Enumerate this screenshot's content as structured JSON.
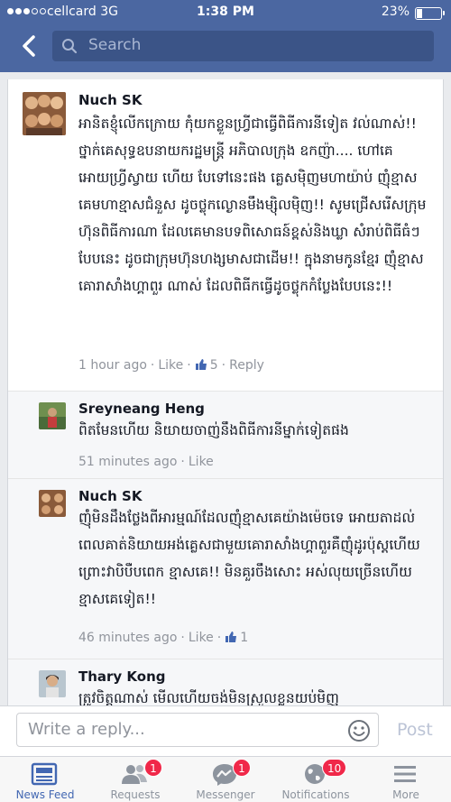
{
  "status_bar": {
    "carrier": "cellcard  3G",
    "time": "1:38 PM",
    "battery": "23%"
  },
  "search": {
    "placeholder": "Search"
  },
  "comments": [
    {
      "author": "Nuch SK",
      "text": "អានិតខ្ញុំលើកក្រោយ កុំយកខ្លួនហ្វ្រីជាធ្វើពិធីការនីទៀត វល់ណាស់!! ថ្នាក់គេសុទ្ធឧបនាយករដ្ឋមន្ត្រី អភិបាលក្រុង ឧកញ៉ា.... ហៅគេអោយហ្វ្រីស្វាយ ហើយ បែទៅនេះផង គ្លេសម៉ិញមហាយ៉ាប់ ញុំខ្មាសគេមហាខ្មាសជំនួស ដូចថ្លុកល្ងោនមឹងម្ស៉ិលម៉ិញ!! សូមជ្រើសរើសក្រុមហ៊ុនពិធីការណា ដែលគេមានបទពិសោធន៍ខ្ពស់និងឃ្លា សំរាប់ពិធីធំៗបែបនេះ ដូចជាក្រុមហ៊ុនហង្សមាសជាដើម!! ក្នុងនាមកូនខ្មែរ ញ៉ុំខ្មាសគោរាសាំងហ្គាពួរ ណាស់ ដែលពិធីកធ្វើដូចថ្លុកកំប្លែងបែបនេះ!!",
      "time": "1 hour ago",
      "like": "Like",
      "likes": "5",
      "reply": "Reply"
    },
    {
      "author": "Sreyneang Heng",
      "text": "ពិតមែនហើយ និយាយចាញ់នឹងពិធីការនីម្នាក់ទៀតផង",
      "time": "51 minutes ago",
      "like": "Like"
    },
    {
      "author": "Nuch SK",
      "text": "ញ៉ុំមិនដឹងថ្លែងពីអារម្មណ៍ដែលញុំខ្មាសគេយ៉ាងម៉េចទេ អោយតាដល់ពេលគាត់និយាយអង់គ្លេសជាមួយគោរាសាំងហ្គាពួរគឺញុំដូរប៉ុស្តហើយ ព្រោះវាបិបឺបពេក ខ្មាសគេ!! មិនគួរចឹងសោះ អស់លុយច្រើនហើយ ខ្មាសគេទៀត!!",
      "time": "46 minutes ago",
      "like": "Like",
      "likes": "1"
    },
    {
      "author": "Thary Kong",
      "text": "ត្រូវចិត្តណាស់ មើលហើយចង់មិនស្រួលខ្លួនយប់មិញ"
    }
  ],
  "reply_bar": {
    "placeholder": "Write a reply...",
    "post": "Post"
  },
  "tabs": [
    {
      "label": "News Feed",
      "icon": "news-feed-icon"
    },
    {
      "label": "Requests",
      "icon": "friend-requests-icon",
      "badge": "1"
    },
    {
      "label": "Messenger",
      "icon": "messenger-icon",
      "badge": "1"
    },
    {
      "label": "Notifications",
      "icon": "globe-icon",
      "badge": "10"
    },
    {
      "label": "More",
      "icon": "menu-icon"
    }
  ],
  "colors": {
    "brand": "#4b67a1",
    "link_blue": "#4267b2",
    "badge_red": "#f02849"
  }
}
